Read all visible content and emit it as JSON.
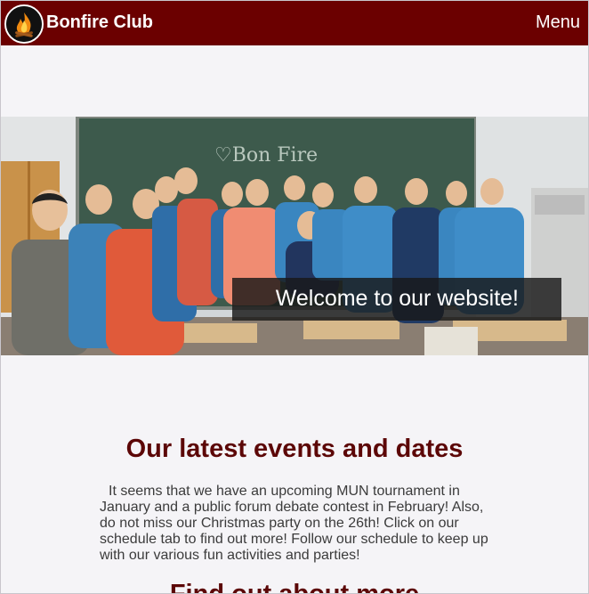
{
  "navbar": {
    "brand": "Bonfire Club",
    "menu_label": "Menu",
    "background_color": "#6b0000",
    "logo_icon": "bonfire-logo-icon"
  },
  "hero": {
    "caption": "Welcome to our website!",
    "board_text": "♡Bon Fire",
    "image_description_icon": "group-photo-classroom"
  },
  "events": {
    "heading": "Our latest events and dates",
    "body": "It seems that we have an upcoming MUN tournament in January and a public forum debate contest in February! Also, do not miss our Christmas party on the 26th! Click on our schedule tab to find out more! Follow our schedule to keep up with our various fun activities and parties!",
    "heading_color": "#5c0707"
  },
  "more": {
    "heading": "Find out about more"
  }
}
